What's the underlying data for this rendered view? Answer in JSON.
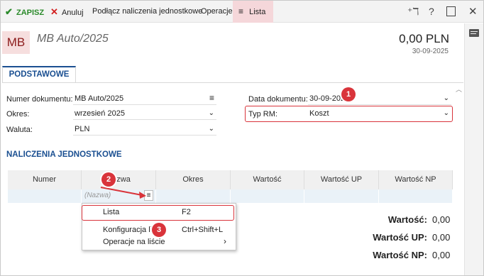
{
  "toolbar": {
    "save_label": "ZAPISZ",
    "cancel_label": "Anuluj",
    "attach_label": "Podłącz naliczenia jednostkowe",
    "operations_label": "Operacje",
    "list_label": "Lista"
  },
  "header": {
    "avatar": "MB",
    "doc_title": "MB Auto/2025",
    "amount": "0,00 PLN",
    "date": "30-09-2025"
  },
  "tab": {
    "label": "PODSTAWOWE"
  },
  "form": {
    "doc_number_label": "Numer dokumentu:",
    "doc_number_value": "MB Auto/2025",
    "period_label": "Okres:",
    "period_value": "wrzesień 2025",
    "currency_label": "Waluta:",
    "currency_value": "PLN",
    "doc_date_label": "Data dokumentu:",
    "doc_date_value": "30-09-2025",
    "rm_type_label": "Typ RM:",
    "rm_type_value": "Koszt"
  },
  "section_title": "NALICZENIA JEDNOSTKOWE",
  "grid": {
    "columns": [
      "Numer",
      "Nazwa",
      "Okres",
      "Wartość",
      "Wartość UP",
      "Wartość NP"
    ],
    "name_placeholder": "(Nazwa)"
  },
  "menu": {
    "items": [
      {
        "label": "Lista",
        "shortcut": "F2"
      },
      {
        "label": "Konfiguracja listy",
        "shortcut": "Ctrl+Shift+L"
      },
      {
        "label": "Operacje na liście",
        "shortcut": "›"
      }
    ]
  },
  "totals": [
    {
      "label": "Wartość:",
      "value": "0,00"
    },
    {
      "label": "Wartość UP:",
      "value": "0,00"
    },
    {
      "label": "Wartość NP:",
      "value": "0,00"
    }
  ],
  "badges": [
    "1",
    "2",
    "3"
  ],
  "colors": {
    "accent": "#1a4f91",
    "highlight": "#d9343b",
    "save": "#2a8a2a",
    "cancel": "#d22020"
  }
}
